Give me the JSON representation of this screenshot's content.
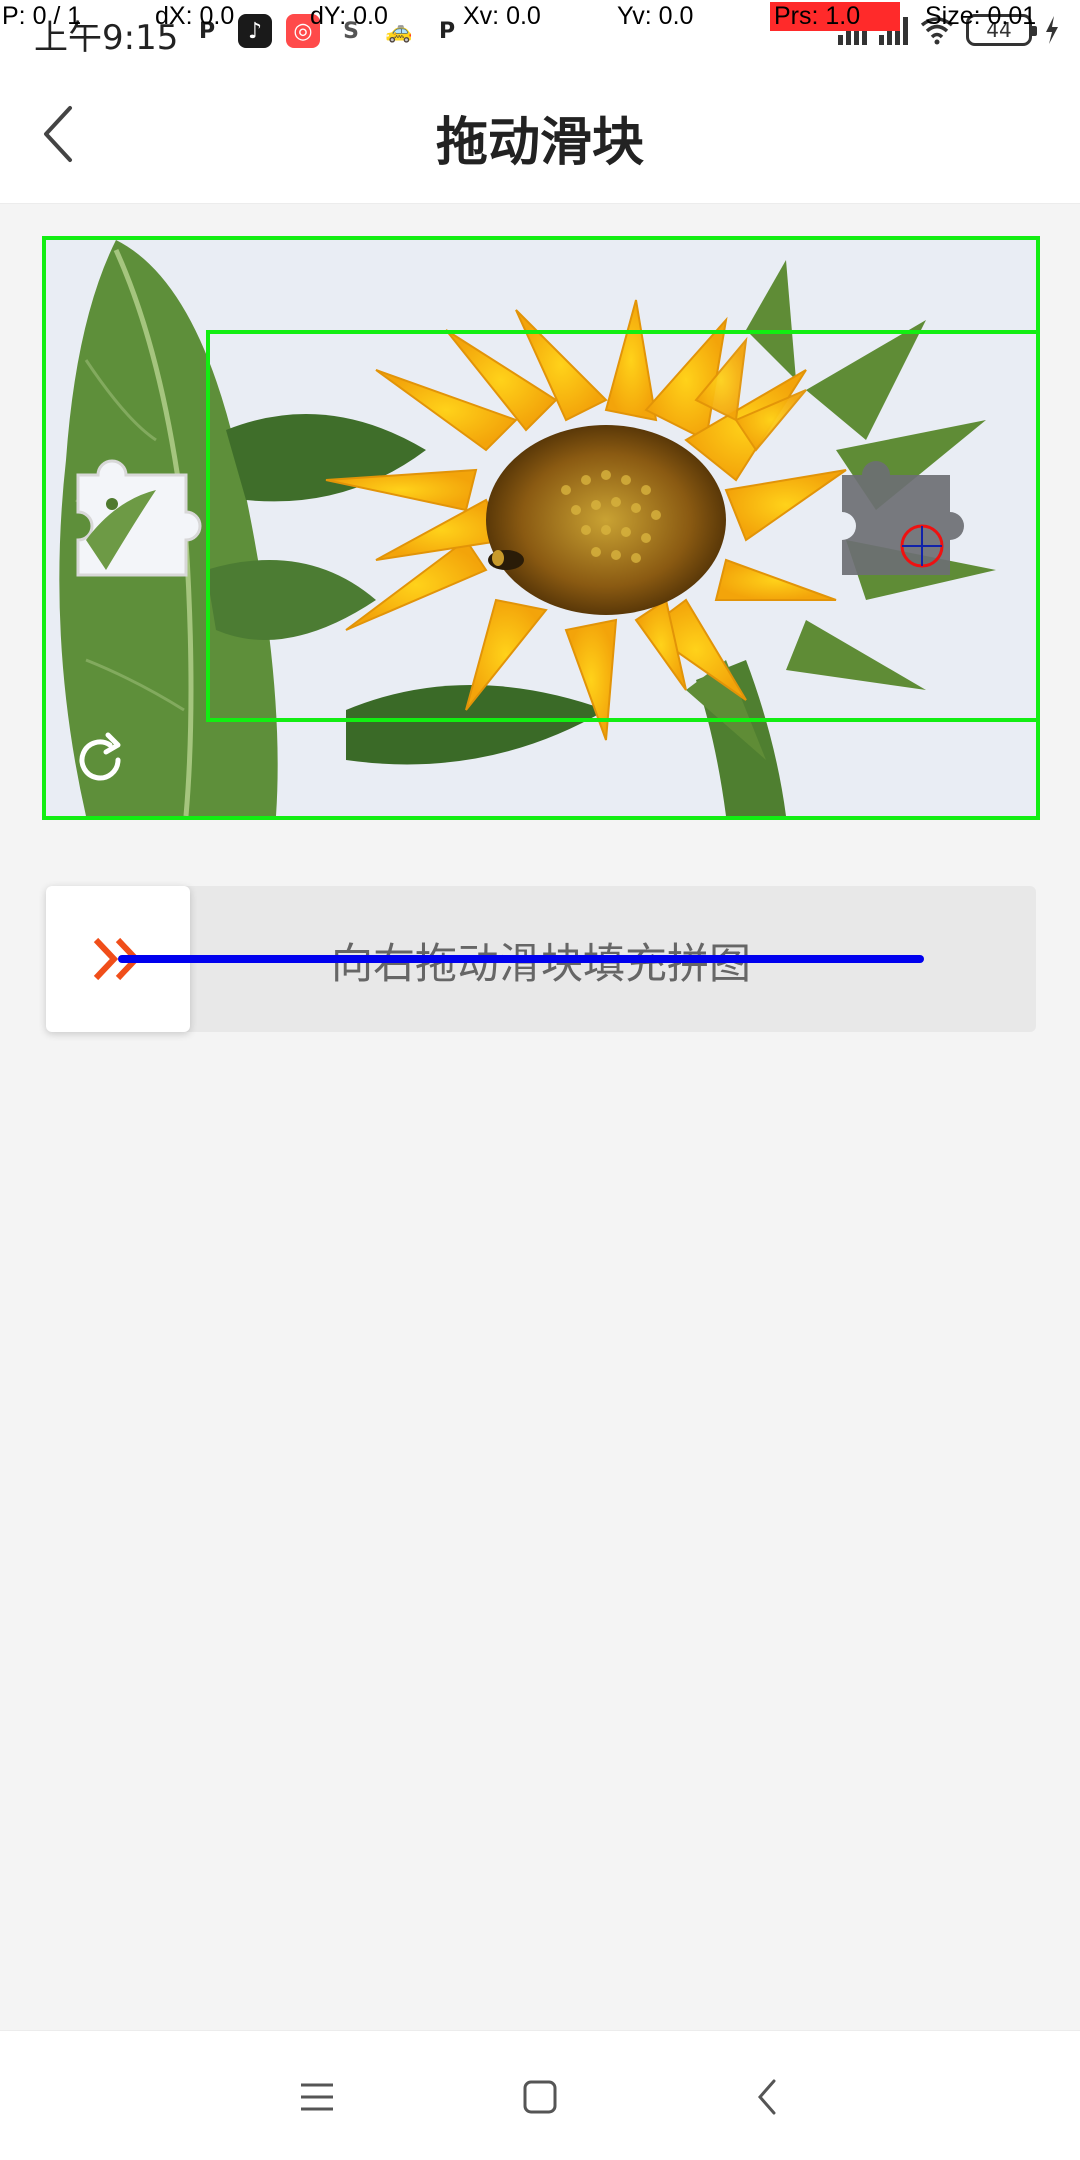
{
  "status_bar": {
    "time": "上午9:15",
    "apps": [
      {
        "icon": "p-app-icon",
        "glyph": "P",
        "bg": "#ffffff",
        "fg": "#222222"
      },
      {
        "icon": "tiktok-icon",
        "glyph": "♪",
        "bg": "#1a1a1a",
        "fg": "#ffffff"
      },
      {
        "icon": "kuaishou-icon",
        "glyph": "◎",
        "bg": "#ff4a4a",
        "fg": "#ffffff"
      },
      {
        "icon": "swirl-app-icon",
        "glyph": "S",
        "bg": "#ffffff",
        "fg": "#555555"
      },
      {
        "icon": "taxi-icon",
        "glyph": "🚕",
        "bg": "#ffffff",
        "fg": "#222222"
      },
      {
        "icon": "p-app-icon-2",
        "glyph": "P",
        "bg": "#ffffff",
        "fg": "#222222"
      }
    ],
    "battery_level": "44"
  },
  "debug_overlay": {
    "p": "P: 0 / 1",
    "dx": "dX: 0.0",
    "dy": "dY: 0.0",
    "xv": "Xv: 0.0",
    "yv": "Yv: 0.0",
    "prs": "Prs: 1.0",
    "size": "Size: 0.01"
  },
  "header": {
    "title": "拖动滑块"
  },
  "captcha": {
    "image_subject": "sunflower"
  },
  "slider": {
    "hint": "向右拖动滑块填充拼图",
    "progress": 0
  },
  "colors": {
    "accent": "#f04e1a",
    "detection_box": "#12ee12",
    "drag_line": "#0000ee",
    "target_marker": "#ee1111"
  }
}
